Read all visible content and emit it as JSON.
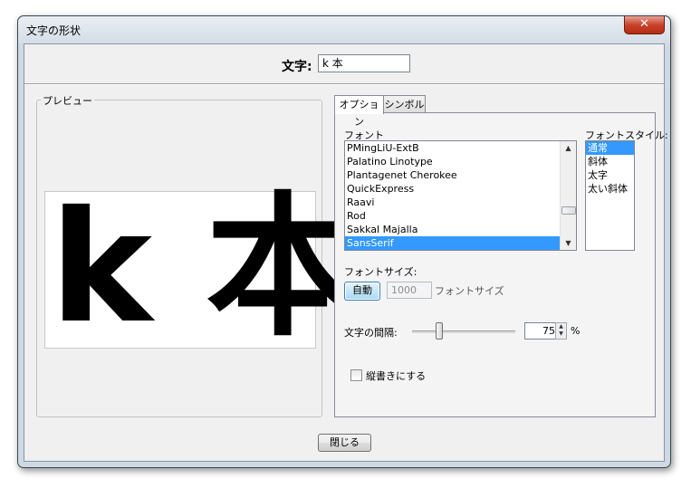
{
  "window": {
    "title": "文字の形状",
    "close_glyph": "✕"
  },
  "char_field": {
    "label": "文字:",
    "value": "k 本"
  },
  "preview": {
    "legend": "プレビュー",
    "sample_text": "k 本"
  },
  "tabs": [
    {
      "label": "オプション",
      "active": true
    },
    {
      "label": "シンボル",
      "active": false
    }
  ],
  "font": {
    "label": "フォント",
    "items": [
      "PMingLiU-ExtB",
      "Palatino Linotype",
      "Plantagenet Cherokee",
      "QuickExpress",
      "Raavi",
      "Rod",
      "Sakkal Majalla",
      "SansSerif"
    ],
    "selected": "SansSerif"
  },
  "font_style": {
    "label": "フォントスタイル:",
    "items": [
      "通常",
      "斜体",
      "太字",
      "太い斜体"
    ],
    "selected": "通常"
  },
  "font_size": {
    "label": "フォントサイズ:",
    "auto_label": "自動",
    "value": "1000",
    "unit_label": "フォントサイズ"
  },
  "spacing": {
    "label": "文字の間隔:",
    "value": "75",
    "unit": "%"
  },
  "vertical": {
    "label": "縦書きにする",
    "checked": false
  },
  "close_button": {
    "label": "閉じる"
  },
  "icons": {
    "scroll_up": "▲",
    "scroll_down": "▼",
    "spin_up": "▲",
    "spin_down": "▼"
  }
}
